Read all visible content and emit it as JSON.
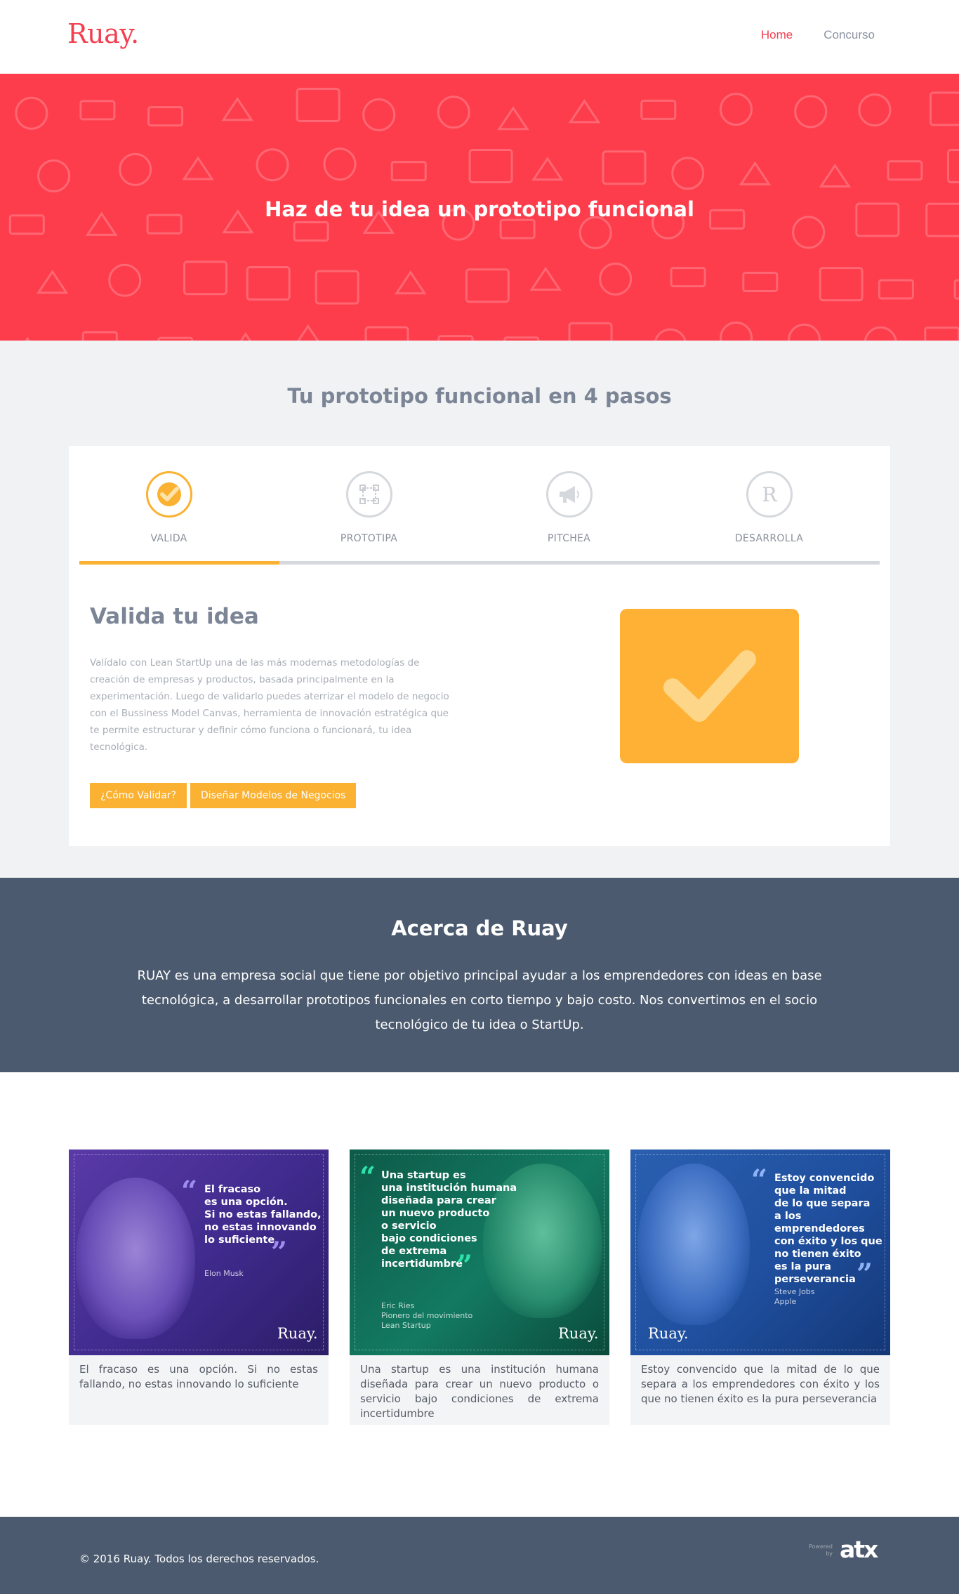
{
  "header": {
    "logo": "Ruay.",
    "nav": [
      {
        "label": "Home",
        "active": true
      },
      {
        "label": "Concurso",
        "active": false
      }
    ]
  },
  "hero": {
    "title": "Haz de tu idea un prototipo funcional",
    "background_color": "#fe3d4c"
  },
  "steps": {
    "heading": "Tu prototipo funcional en 4 pasos",
    "items": [
      {
        "label": "VALIDA",
        "icon": "check-icon",
        "active": true
      },
      {
        "label": "PROTOTIPA",
        "icon": "prototype-frame-icon",
        "active": false
      },
      {
        "label": "PITCHEA",
        "icon": "megaphone-icon",
        "active": false
      },
      {
        "label": "DESARROLLA",
        "icon": "registered-icon",
        "active": false
      }
    ],
    "progress_fraction": 0.25,
    "content": {
      "title": "Valida tu idea",
      "text": "Valídalo con Lean StartUp una de las más modernas metodologías de creación de empresas y productos, basada principalmente en la experimentación. Luego de validarlo puedes aterrizar el modelo de negocio con el Bussiness Model Canvas, herramienta de innovación estratégica que te permite estructurar y definir cómo funciona o funcionará, tu idea tecnológica.",
      "buttons": [
        "¿Cómo Validar?",
        "Diseñar Modelos de Negocios"
      ],
      "illustration_icon": "big-check-icon"
    },
    "accent_color": "#fbb131"
  },
  "about": {
    "title": "Acerca de Ruay",
    "text": "RUAY es una empresa social que tiene por objetivo principal ayudar a los emprendedores con ideas en base tecnológica, a desarrollar prototipos funcionales en corto tiempo y bajo costo. Nos convertimos en el socio tecnológico de tu idea o StartUp."
  },
  "quotes": [
    {
      "image_quote": "El fracaso\nes una opción.\nSi no estas fallando,\nno estas innovando\nlo suficiente",
      "image_author": "Elon Musk",
      "brand": "Ruay.",
      "caption": "El fracaso es una opción. Si no estas fallando, no estas innovando lo suficiente",
      "tint": "#4a2f96"
    },
    {
      "image_quote": "Una startup es\nuna institución humana\ndiseñada para crear\nun nuevo producto\no servicio\nbajo condiciones\nde extrema\nincertidumbre",
      "image_author": "Eric Ries\nPionero del movimiento\nLean Startup",
      "brand": "Ruay.",
      "caption": "Una startup es una institución humana diseñada para crear un nuevo producto o servicio bajo condiciones de extrema incertidumbre",
      "tint": "#0f6b55"
    },
    {
      "image_quote": "Estoy convencido\nque la mitad\nde lo que separa\na los emprendedores\ncon éxito y los que\nno tienen éxito\nes la pura\nperseverancia",
      "image_author": "Steve Jobs\nApple",
      "brand": "Ruay.",
      "caption": "Estoy convencido que la mitad de lo que separa a los emprendedores con éxito y los que no tienen éxito es la pura perseverancia",
      "tint": "#1f4f9e"
    }
  ],
  "footer": {
    "copyright": "© 2016 Ruay. Todos los derechos reservados.",
    "powered_by": "Powered\nby",
    "powered_logo": "atx"
  }
}
